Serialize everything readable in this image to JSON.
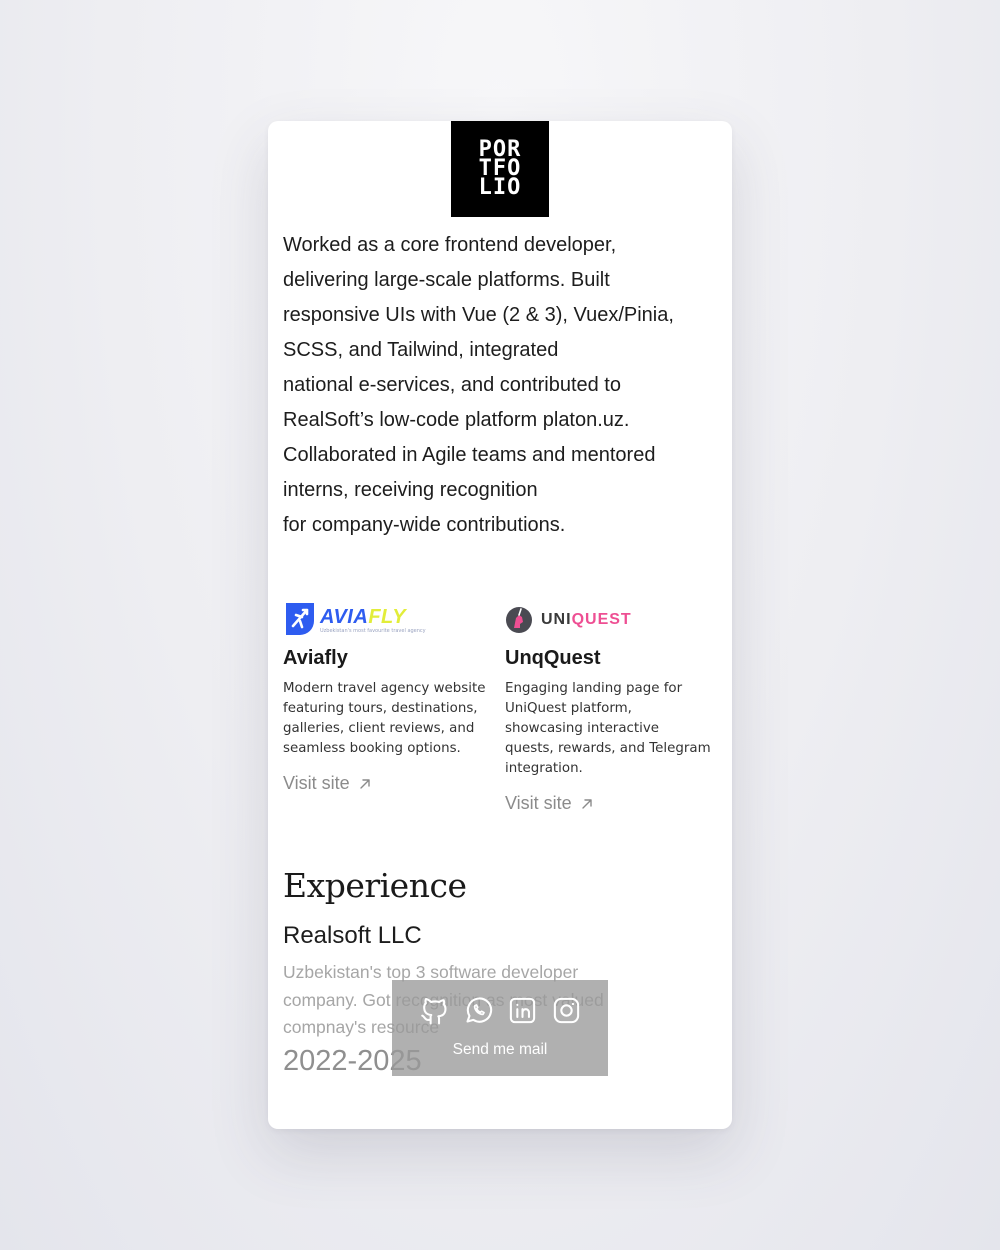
{
  "header": {
    "logo_lines": [
      "POR",
      "TFO",
      "LIO"
    ]
  },
  "intro": {
    "lines": [
      "Worked as a core frontend developer,",
      "delivering large-scale platforms. Built",
      "responsive UIs with Vue (2 & 3), Vuex/Pinia,",
      "SCSS, and Tailwind, integrated",
      "national e-services, and contributed to",
      "RealSoft’s low-code platform platon.uz.",
      "Collaborated in Agile teams and mentored",
      "interns, receiving recognition",
      "for company-wide contributions."
    ]
  },
  "projects": [
    {
      "logo_text_a": "AVIA",
      "logo_text_b": "FLY",
      "logo_tagline": "Uzbekistan's most favourite travel agency",
      "title": "Aviafly",
      "description_lines": [
        "Modern travel agency website",
        "featuring tours, destinations,",
        "galleries, client reviews, and",
        "seamless booking options."
      ],
      "link_label": "Visit site"
    },
    {
      "logo_text_a": "UNI",
      "logo_text_b": "QUEST",
      "title": "UnqQuest",
      "description_lines": [
        "Engaging landing page for",
        "UniQuest platform,",
        "showcasing interactive",
        "quests, rewards, and Telegram",
        "integration."
      ],
      "link_label": "Visit site"
    }
  ],
  "experience": {
    "heading": "Experience",
    "company": "Realsoft LLC",
    "description_lines": [
      "Uzbekistan's top 3 software developer",
      "company. Got recognition as most valued",
      "compnay's resource"
    ],
    "years": "2022-2025"
  },
  "contact": {
    "icons": [
      "github-icon",
      "whatsapp-icon",
      "linkedin-icon",
      "instagram-icon"
    ],
    "mail_label": "Send me mail"
  },
  "colors": {
    "aviafly_blue": "#2e5cf0",
    "aviafly_yellow": "#e2ed3a",
    "uniquest_pink": "#ee4f93",
    "contact_bar": "#9a9a9a"
  }
}
